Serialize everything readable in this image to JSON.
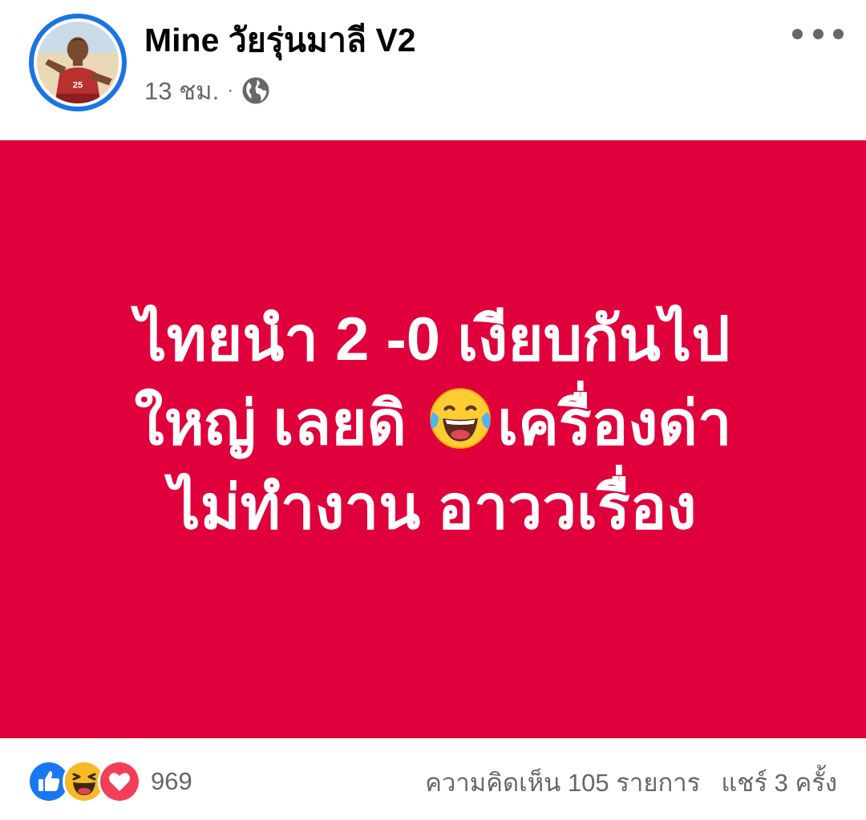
{
  "post": {
    "author_name": "Mine วัยรุ่นมาลี V2",
    "time": "13 ชม.",
    "separator": "·",
    "privacy_icon": "globe-icon",
    "more_icon": "more-options-icon",
    "avatar_jersey_number": "25",
    "background_color": "#e0003b",
    "text_lines": [
      "ไทยนำ 2 -0 เงียบกันไป",
      "ใหญ่ เลยดิ",
      "เครื่องด่า",
      "ไม่ทำงาน อาววเรื่อง"
    ],
    "inline_emoji": "crying-laughing-emoji-icon"
  },
  "footer": {
    "reaction_icons": [
      "like-reaction-icon",
      "haha-reaction-icon",
      "love-reaction-icon"
    ],
    "reaction_count": "969",
    "comments_label": "ความคิดเห็น 105 รายการ",
    "shares_label": "แชร์ 3 ครั้ง"
  },
  "colors": {
    "like": "#1877f2",
    "haha": "#f7b928",
    "love": "#f33e58",
    "text_secondary": "#65676b"
  }
}
